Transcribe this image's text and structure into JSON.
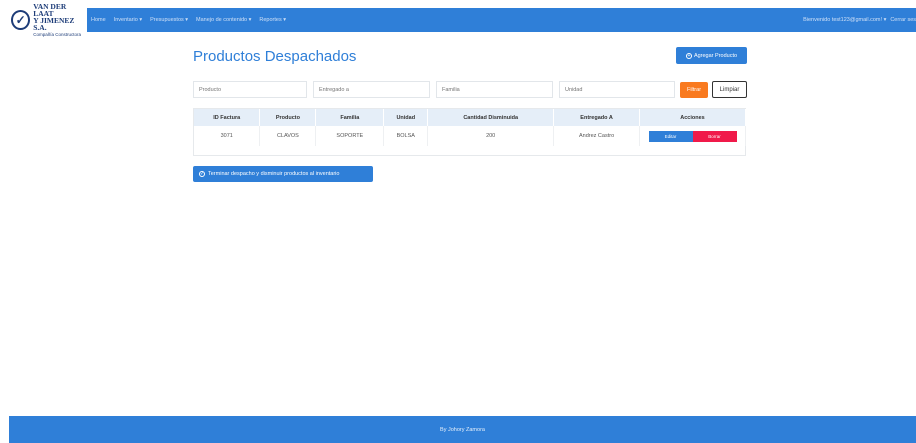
{
  "brand": {
    "line1": "VAN DER LAAT",
    "line2": "Y JIMENEZ S.A.",
    "line3": "Compañía Constructora",
    "logo_icon": "check-icon"
  },
  "nav": {
    "items": [
      "Home",
      "Inventario ▾",
      "Presupuestos ▾",
      "Manejo de contenido ▾",
      "Reportes ▾"
    ],
    "user": "Bienvenido test123@gmail.com! ▾",
    "logout": "Cerrar ses"
  },
  "page": {
    "title": "Productos Despachados",
    "add_button": "Agregar Producto"
  },
  "filters": {
    "producto_placeholder": "Producto",
    "entregado_placeholder": "Entregado a",
    "familia_placeholder": "Familia",
    "unidad_placeholder": "Unidad",
    "filtrar": "Filtrar",
    "limpiar": "Limpiar"
  },
  "table": {
    "headers": [
      "ID Factura",
      "Producto",
      "Familia",
      "Unidad",
      "Cantidad Disminuida",
      "Entregado A",
      "Acciones"
    ],
    "rows": [
      [
        "3071",
        "CLAVOS",
        "SOPORTE",
        "BOLSA",
        "200",
        "Andrez Castro"
      ]
    ],
    "edit_label": "Editar",
    "delete_label": "Borrar"
  },
  "finish_button": "Terminar despacho y disminuir productos al inventario",
  "footer": "By Johory Zamora",
  "colors": {
    "primary": "#2f7fd8",
    "orange": "#f97a1f",
    "danger": "#f01a4a",
    "header_bg": "#e5eef8"
  }
}
